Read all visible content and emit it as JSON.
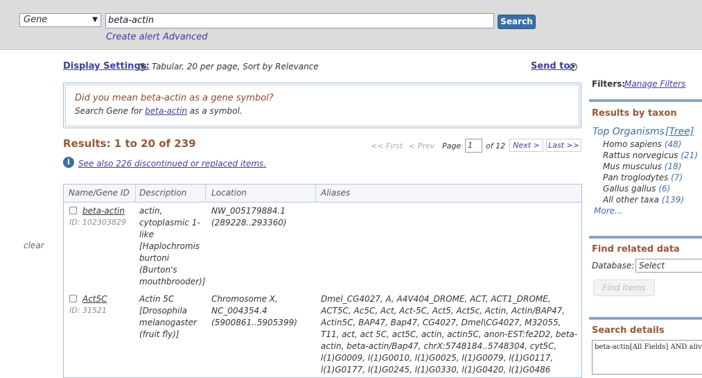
{
  "header": {
    "database": "Gene",
    "query": "beta-actin",
    "search_label": "Search",
    "create_alert": "Create alert",
    "advanced": "Advanced"
  },
  "display": {
    "settings_label": "Display Settings:",
    "settings_value": "Tabular, 20 per page, Sort by Relevance",
    "send_to": "Send to:"
  },
  "did_you_mean": {
    "title": "Did you mean beta-actin as a gene symbol?",
    "prefix": "Search Gene for ",
    "link": "beta-actin",
    "suffix": " as a symbol."
  },
  "results": {
    "count": "Results: 1 to 20 of 239",
    "see_also": "See also 226 discontinued or replaced items.",
    "clear": "clear"
  },
  "pagination": {
    "first": "<< First",
    "prev": "< Prev",
    "page_label": "Page",
    "page_value": "1",
    "of": "of 12",
    "next": "Next >",
    "last": "Last >>"
  },
  "table": {
    "headers": [
      "Name/Gene ID",
      "Description",
      "Location",
      "Aliases"
    ],
    "rows": [
      {
        "name": "beta-actin",
        "id": "ID: 102303829",
        "description": [
          "actin,",
          "cytoplasmic 1-",
          "like",
          "[Haplochromis",
          "burtoni",
          "(Burton's",
          "mouthbrooder)]"
        ],
        "location": [
          "NW_005179884.1",
          "(289228..293360)"
        ],
        "aliases": []
      },
      {
        "name": "Act5C",
        "id": "ID: 31521",
        "description": [
          "Actin 5C",
          "[Drosophila",
          "melanogaster",
          "(fruit fly)]"
        ],
        "location": [
          "Chromosome X,",
          "NC_004354.4",
          "(5900861..5905399)"
        ],
        "aliases": [
          "Dmel_CG4027, A, A4V404_DROME, ACT, ACT1_DROME,",
          "ACT5C, Ac5C, Act, Act-5C, Act5, Act5c, Actin, Actin/BAP47,",
          "Actin5C, BAP47, Bap47, CG4027, Dmel\\CG4027, M32055,",
          "T11, act, act 5C, act5C, actin, actin5C, anon-EST:fe2D2, beta-",
          "actin, beta-actin/Bap47, chrX:5748184..5748304, cyt5C,",
          "l(1)G0009, l(1)G0010, l(1)G0025, l(1)G0079, l(1)G0117,",
          "l(1)G0177, l(1)G0245, l(1)G0330, l(1)G0420, l(1)G0486"
        ]
      }
    ]
  },
  "sidebar": {
    "filters_label": "Filters:",
    "manage_filters": "Manage Filters",
    "taxon_heading": "Results by taxon",
    "top_organisms": "Top Organisms",
    "tree": "[Tree]",
    "taxa": [
      {
        "name": "Homo sapiens",
        "count": "(48)"
      },
      {
        "name": "Rattus norvegicus",
        "count": "(21)"
      },
      {
        "name": "Mus musculus",
        "count": "(18)"
      },
      {
        "name": "Pan troglodytes",
        "count": "(7)"
      },
      {
        "name": "Gallus gallus",
        "count": "(6)"
      },
      {
        "name": "All other taxa",
        "count": "(139)"
      }
    ],
    "more": "More...",
    "related_heading": "Find related data",
    "database_label": "Database:",
    "database_value": "Select",
    "find_items": "Find items",
    "details_heading": "Search details",
    "details_text": "beta-actin[All Fields] AND alive[prop]"
  },
  "colors": {
    "header_bg": "#dcdcdc",
    "search_button": "#3a6ea5",
    "heading_brown": "#985735",
    "link_blue": "#3c3ca5",
    "sidebar_rule": "#8aa6bf"
  }
}
